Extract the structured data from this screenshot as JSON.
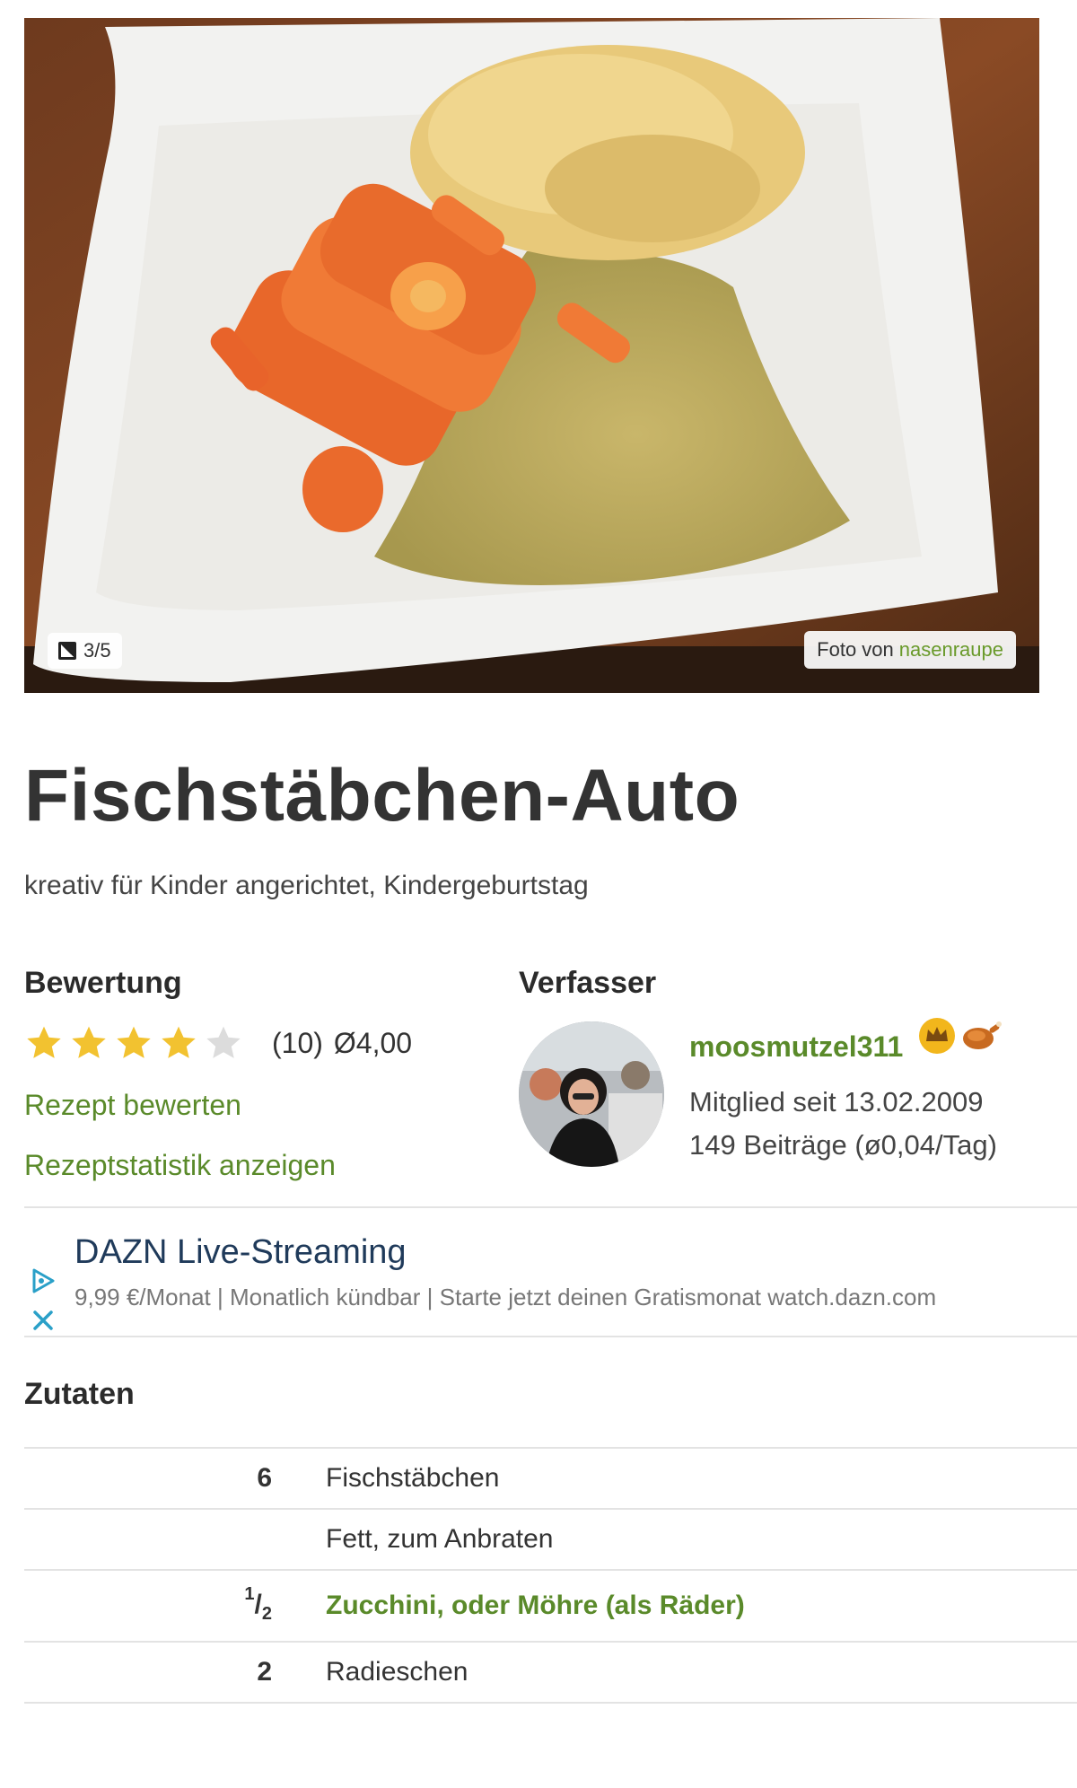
{
  "photo": {
    "pager": "3/5",
    "credit_prefix": "Foto von",
    "credit_user": "nasenraupe"
  },
  "recipe": {
    "title": "Fischstäbchen-Auto",
    "subtitle": "kreativ für Kinder angerichtet, Kindergeburtstag"
  },
  "rating": {
    "heading": "Bewertung",
    "stars": 4,
    "max_stars": 5,
    "count": "(10)",
    "average": "Ø4,00",
    "rate_link": "Rezept bewerten",
    "stats_link": "Rezeptstatistik anzeigen"
  },
  "author": {
    "heading": "Verfasser",
    "name": "moosmutzel311",
    "member_since": "Mitglied seit 13.02.2009",
    "posts": "149 Beiträge (ø0,04/Tag)",
    "badges": [
      "crown-icon",
      "chicken-icon"
    ]
  },
  "ad": {
    "title": "DAZN Live-Streaming",
    "text": "9,99 €/Monat | Monatlich kündbar | Starte jetzt deinen Gratismonat watch.dazn.com"
  },
  "ingredients": {
    "heading": "Zutaten",
    "items": [
      {
        "qty": "6",
        "name": "Fischstäbchen"
      },
      {
        "qty": "",
        "name": "Fett, zum Anbraten"
      },
      {
        "qty_num": "1",
        "qty_den": "2",
        "name": "Zucchini, oder Möhre (als Räder)"
      },
      {
        "qty": "2",
        "name": "Radieschen"
      }
    ]
  },
  "colors": {
    "accent_green": "#5a8a2a",
    "star_gold": "#f2c230",
    "star_empty": "#dcdcdc"
  }
}
